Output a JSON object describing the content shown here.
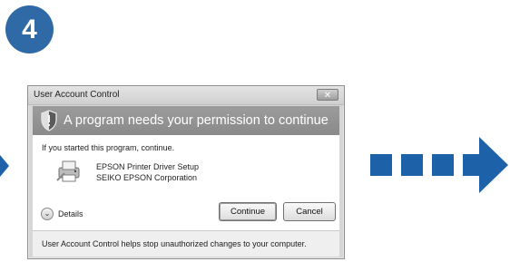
{
  "step": {
    "number": "4",
    "badge_color": "#2f6aa6"
  },
  "dialog": {
    "title": "User Account Control",
    "close_label": "✕",
    "heading": "A program needs your permission to continue",
    "intro": "If you started this program, continue.",
    "program": {
      "icon": "printer-setup-icon",
      "name": "EPSON Printer Driver Setup",
      "publisher": "SEIKO EPSON Corporation"
    },
    "details_label": "Details",
    "buttons": {
      "continue": "Continue",
      "cancel": "Cancel"
    },
    "footer": "User Account Control helps stop unauthorized changes to your computer."
  },
  "arrow": {
    "icon": "next-step-arrow-icon",
    "color": "#1d62a8"
  }
}
